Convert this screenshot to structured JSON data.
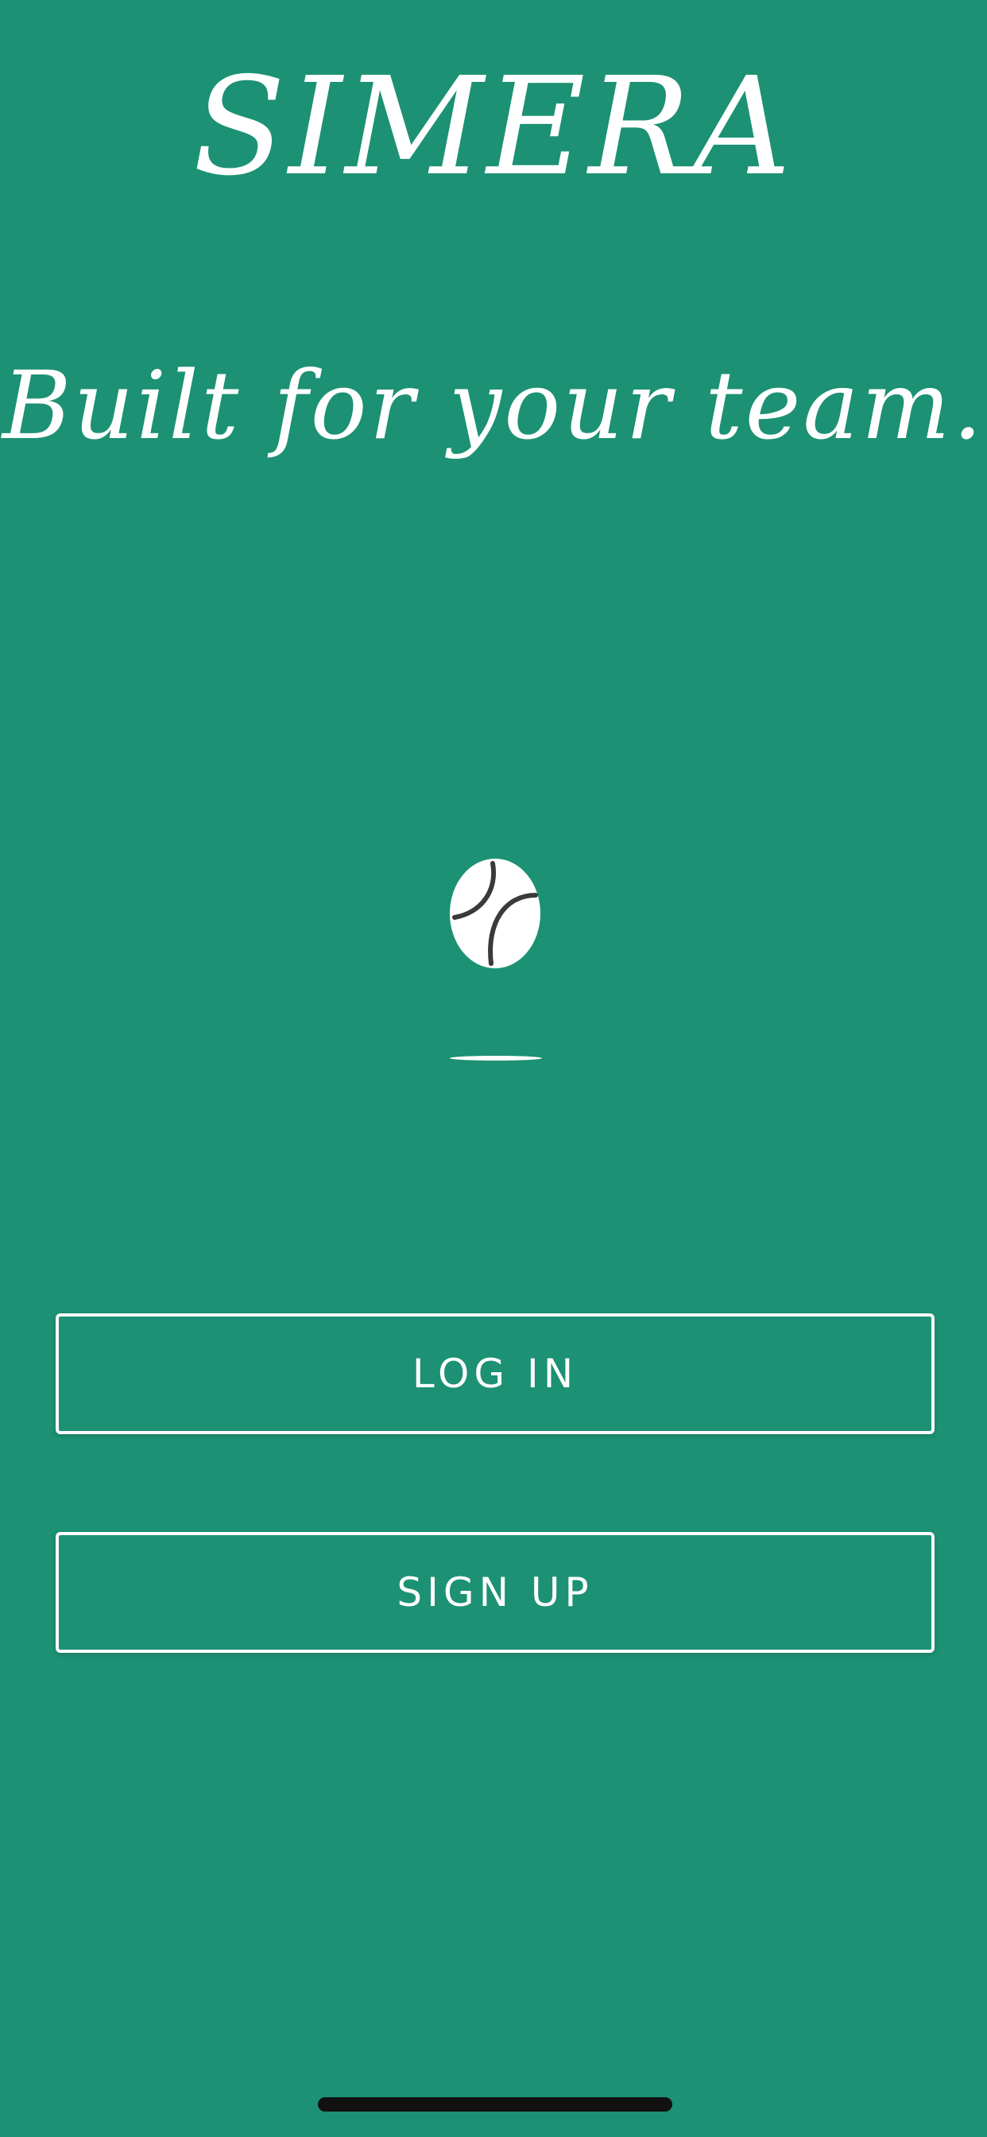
{
  "app": {
    "title": "SIMERA",
    "tagline": "Built for your team."
  },
  "buttons": {
    "login_label": "LOG IN",
    "signup_label": "SIGN UP"
  },
  "colors": {
    "background": "#1c9174",
    "foreground": "#ffffff",
    "ball_seam": "#3a3a3a",
    "home_indicator": "#111111"
  },
  "icons": {
    "loading": "tennis-ball-icon"
  }
}
